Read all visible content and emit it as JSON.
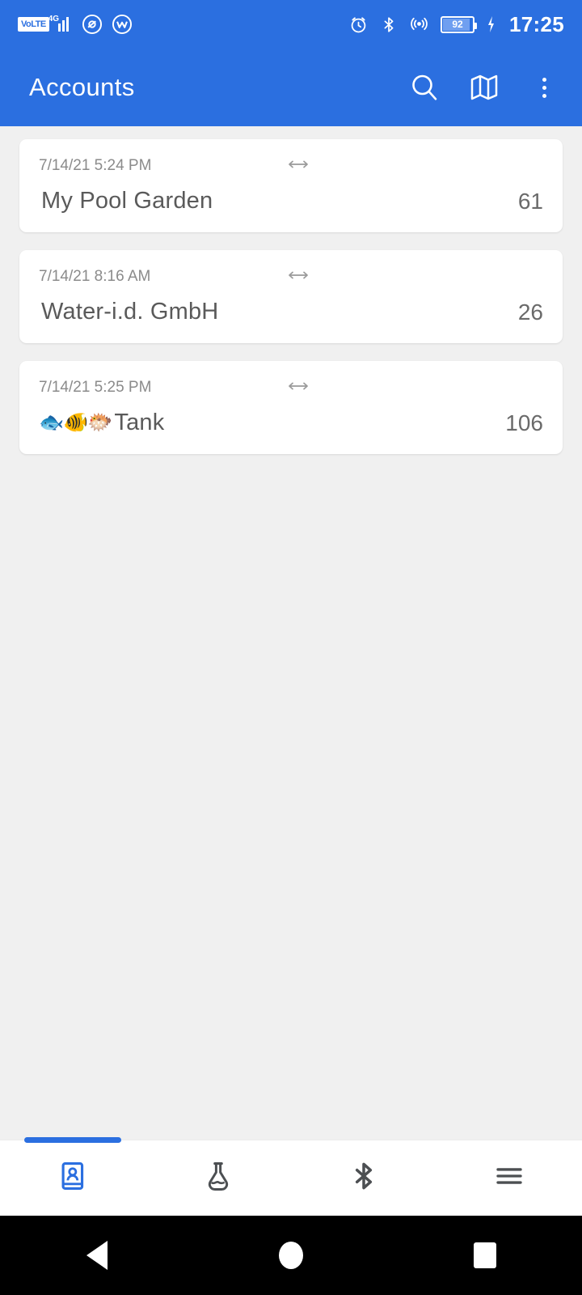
{
  "statusbar": {
    "volte_label": "VoLTE",
    "network_label": "4G",
    "battery_level": "92",
    "time": "17:25",
    "icons": [
      "volte-badge",
      "signal-bars-icon",
      "app-circle-icon",
      "app-circle-icon-2",
      "alarm-icon",
      "bluetooth-icon",
      "hotspot-icon",
      "battery-icon",
      "charging-bolt-icon"
    ]
  },
  "appbar": {
    "title": "Accounts",
    "search_icon": "search-icon",
    "map_icon": "map-icon",
    "overflow_icon": "overflow-menu-icon"
  },
  "accounts": [
    {
      "date": "7/14/21 5:24 PM",
      "emoji": "",
      "name": "My Pool Garden",
      "count": "61",
      "swap_icon": "left-right-arrow-icon"
    },
    {
      "date": "7/14/21 8:16 AM",
      "emoji": "",
      "name": "Water-i.d. GmbH",
      "count": "26",
      "swap_icon": "left-right-arrow-icon"
    },
    {
      "date": "7/14/21 5:25 PM",
      "emoji": "🐟🐠🐡",
      "name": "Tank",
      "count": "106",
      "swap_icon": "left-right-arrow-icon"
    }
  ],
  "bottomnav": {
    "active_index": 0,
    "accent_color": "#2b6fe0",
    "items": [
      {
        "name": "accounts-tab",
        "icon": "contact-book-icon",
        "active": true
      },
      {
        "name": "measurements-tab",
        "icon": "flask-icon",
        "active": false
      },
      {
        "name": "bluetooth-tab",
        "icon": "bluetooth-icon",
        "active": false
      },
      {
        "name": "menu-tab",
        "icon": "hamburger-menu-icon",
        "active": false
      }
    ]
  },
  "sysnav": {
    "back_icon": "back-triangle-icon",
    "home_icon": "home-circle-icon",
    "recents_icon": "recents-square-icon"
  },
  "theme": {
    "primary": "#2b6fe0",
    "background": "#f0f0f0",
    "card": "#ffffff",
    "text_muted": "#8b8b8b"
  }
}
